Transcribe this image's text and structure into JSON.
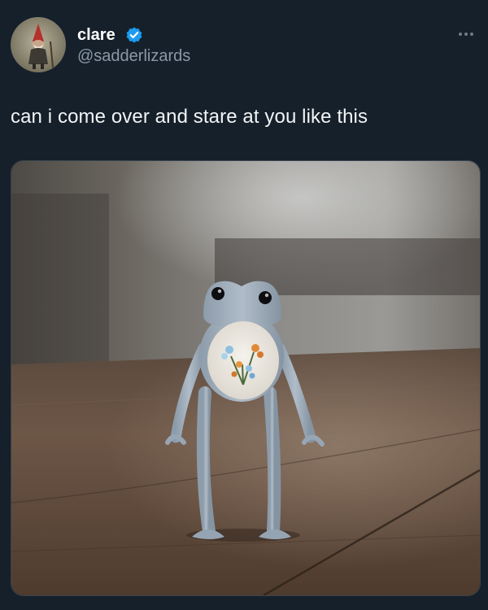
{
  "author": {
    "display_name": "clare",
    "handle": "@sadderlizards",
    "verified": true
  },
  "tweet": {
    "text": "can i come over and stare at you like this"
  },
  "icons": {
    "avatar": "gnome-avatar",
    "verified": "verified-badge-icon",
    "more": "more-options-icon"
  },
  "colors": {
    "background": "#15202b",
    "text": "#f2f4f5",
    "secondary_text": "#8b98a5",
    "verified": "#1d9bf0"
  }
}
